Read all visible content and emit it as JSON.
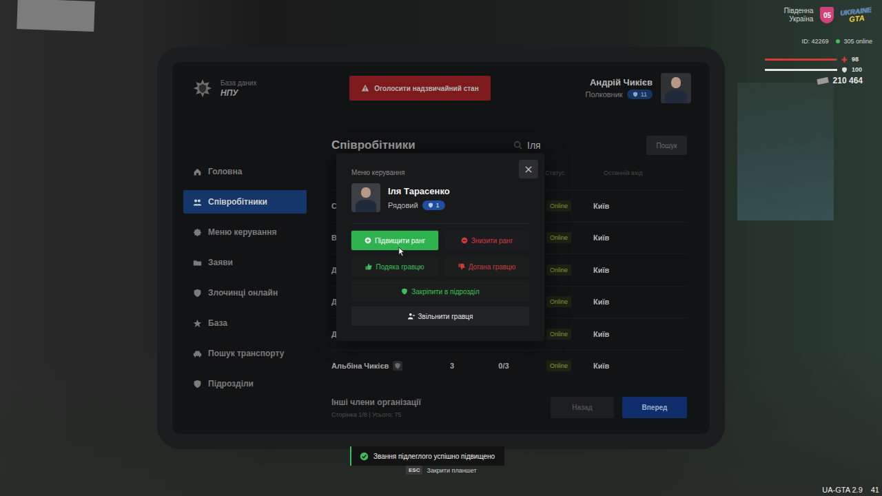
{
  "hud": {
    "region_lines": [
      "Південна",
      "Україна"
    ],
    "server_badge": "05",
    "logo_lines": [
      "UKRAINE",
      "GTA"
    ],
    "id": "ID: 42269",
    "online": "305 online",
    "health": {
      "reading": "98",
      "level": 0.98
    },
    "armor": {
      "reading": "100",
      "level": 1
    },
    "money": "210 464"
  },
  "tablet": {
    "brand": {
      "title": "База даних",
      "name": "НПУ"
    },
    "alert_button": "Оголосити надзвичайний стан",
    "user": {
      "name": "Андрій Чикієв",
      "rank": "Полковник",
      "rank_level": "11"
    },
    "sidebar": {
      "items": [
        {
          "label": "Головна",
          "selected": false
        },
        {
          "label": "Співробітники",
          "selected": true
        },
        {
          "label": "Меню керування",
          "selected": false
        },
        {
          "label": "Заяви",
          "selected": false
        },
        {
          "label": "Злочинці онлайн",
          "selected": false
        },
        {
          "label": "База",
          "selected": false
        },
        {
          "label": "Пошук транспорту",
          "selected": false
        },
        {
          "label": "Підрозділи",
          "selected": false
        }
      ]
    },
    "page": {
      "title": "Співробітники",
      "search": {
        "value": "Іля",
        "button": "Пошук"
      }
    },
    "table": {
      "columns": [
        "Статус",
        "Останній вхід"
      ],
      "rows": [
        {
          "name": "С",
          "rank": "",
          "warnings": "",
          "badge": false,
          "status": "Online",
          "city": "Київ"
        },
        {
          "name": "В",
          "rank": "",
          "warnings": "",
          "badge": false,
          "status": "Online",
          "city": "Київ"
        },
        {
          "name": "Д",
          "rank": "",
          "warnings": "",
          "badge": false,
          "status": "Online",
          "city": "Київ"
        },
        {
          "name": "Д",
          "rank": "",
          "warnings": "",
          "badge": false,
          "status": "Online",
          "city": "Київ"
        },
        {
          "name": "Д",
          "rank": "",
          "warnings": "",
          "badge": false,
          "status": "Online",
          "city": "Київ"
        },
        {
          "name": "Альбіна Чикієв",
          "rank": "3",
          "warnings": "0/3",
          "badge": true,
          "status": "Online",
          "city": "Київ"
        }
      ]
    },
    "footer": {
      "title": "Інші члени організації",
      "pages": "Сторінка 1/8 | Усього: 75",
      "prev": "Назад",
      "next": "Вперед"
    }
  },
  "modal": {
    "title": "Меню керування",
    "close": "×",
    "player": {
      "name": "Іля Тарасенко",
      "rank": "Рядовий",
      "rank_level": "1"
    },
    "rank_actions": [
      {
        "label": "Підвищити ранг",
        "color": "#2fb34f",
        "filled": true,
        "hovered": true
      },
      {
        "label": "Знизити ранг",
        "color": "#d23b3b",
        "filled": false,
        "hovered": false
      }
    ],
    "feedback_actions": [
      {
        "label": "Подяка гравцю",
        "color": "#3cbf5a",
        "filled": false,
        "hovered": false
      },
      {
        "label": "Догана гравцю",
        "color": "#cc3c3c",
        "filled": false,
        "hovered": false
      }
    ],
    "wide_actions": [
      {
        "label": "Закріпити в підрозділ",
        "color": "#3cbf5a",
        "filled": false,
        "hovered": false
      },
      {
        "label": "Звільнити гравця",
        "color": "#e8e8e8",
        "filled": false,
        "hovered": false
      }
    ]
  },
  "toast": {
    "text": "Звання підлеглого успішно підвищено"
  },
  "hint": {
    "key": "ESC",
    "text": "Закрити планшет"
  },
  "version": {
    "text": "UA-GTA 2.9",
    "fps": "41"
  }
}
